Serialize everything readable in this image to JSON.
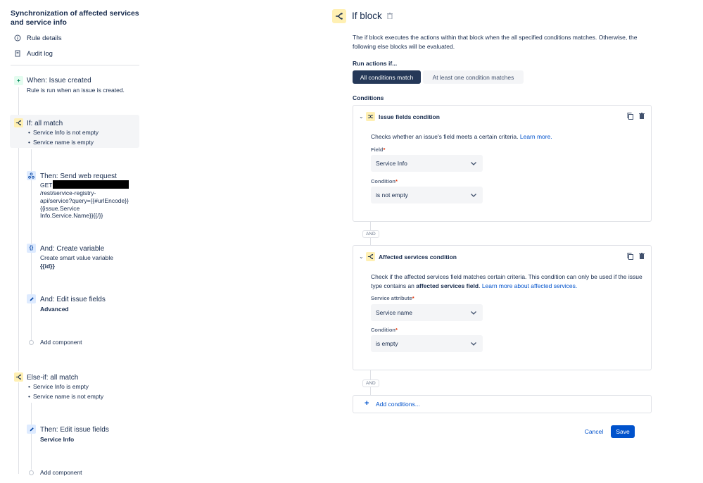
{
  "sidebar": {
    "rule_title": "Synchronization of affected services and service info",
    "links": [
      {
        "label": "Rule details",
        "icon": "info-icon"
      },
      {
        "label": "Audit log",
        "icon": "document-icon"
      }
    ],
    "trigger": {
      "title": "When: Issue created",
      "subtitle": "Rule is run when an issue is created."
    },
    "if_block": {
      "title": "If: all match",
      "bullets": [
        "Service Info is not empty",
        "Service name is empty"
      ]
    },
    "web_request": {
      "title": "Then: Send web request",
      "lines": [
        "GET",
        "/rest/service-registry-",
        "api/service?query={{#urlEncode}}",
        "{{issue.Service",
        "Info.Service.Name}}{{/}}"
      ]
    },
    "create_variable": {
      "title": "And: Create variable",
      "subtitle": "Create smart value variable",
      "value": "{{id}}"
    },
    "edit_fields_1": {
      "title": "And: Edit issue fields",
      "value": "Advanced"
    },
    "add_component_1": "Add component",
    "else_if": {
      "title": "Else-if: all match",
      "bullets": [
        "Service Info is empty",
        "Service name is not empty"
      ]
    },
    "edit_fields_2": {
      "title": "Then: Edit issue fields",
      "value": "Service Info"
    },
    "add_component_2": "Add component"
  },
  "panel": {
    "title": "If block",
    "description": "The if block executes the actions within that block when the all specified conditions matches. Otherwise, the following else blocks will be evaluated.",
    "run_actions_label": "Run actions if...",
    "options": [
      "All conditions match",
      "At least one condition matches"
    ],
    "conditions_label": "Conditions",
    "issue_fields_condition": {
      "title": "Issue fields condition",
      "text": "Checks whether an issue's field meets a certain criteria.",
      "link": "Learn more.",
      "field_label": "Field",
      "field_value": "Service Info",
      "condition_label": "Condition",
      "condition_value": "is not empty"
    },
    "and_label": "AND",
    "affected_services_condition": {
      "title": "Affected services condition",
      "text_1": "Check if the affected services field matches certain criteria. This condition can only be used if the issue type contains an ",
      "text_bold": "affected services field",
      "text_2": ". ",
      "link": "Learn more about affected services.",
      "attribute_label": "Service attribute",
      "attribute_value": "Service name",
      "condition_label": "Condition",
      "condition_value": "is empty"
    },
    "and_label_2": "AND",
    "add_conditions": "Add conditions...",
    "cancel": "Cancel",
    "save": "Save"
  },
  "colors": {
    "primary": "#0052cc",
    "dark_selected": "#253858",
    "condition_yellow": "#fff0b3",
    "trigger_green": "#e3fcef",
    "action_blue": "#deebff"
  }
}
